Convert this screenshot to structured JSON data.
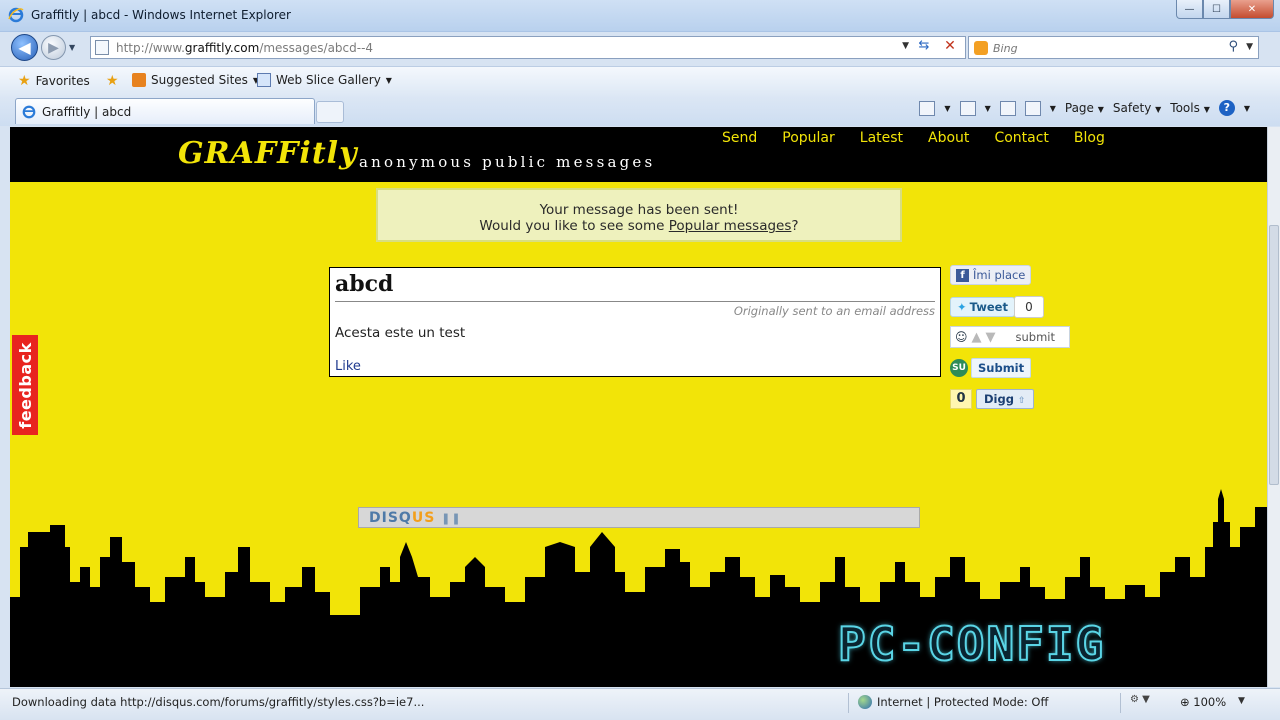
{
  "window": {
    "title": "Graffitly | abcd - Windows Internet Explorer",
    "min": "—",
    "max": "☐",
    "close": "✕"
  },
  "address": {
    "url_prefix": "http://www.",
    "url_host": "graffitly.com",
    "url_path": "/messages/abcd--4",
    "search_placeholder": "Bing"
  },
  "favorites": {
    "favorites_label": "Favorites",
    "suggested_label": "Suggested Sites",
    "webslice_label": "Web Slice Gallery"
  },
  "tab": {
    "title": "Graffitly | abcd"
  },
  "commandbar": {
    "page": "Page",
    "safety": "Safety",
    "tools": "Tools"
  },
  "site": {
    "logo": "GRAFFitly",
    "tagline": "anonymous public messages",
    "nav": [
      "Send",
      "Popular",
      "Latest",
      "About",
      "Contact",
      "Blog"
    ],
    "notice_line1": "Your message has been sent!",
    "notice_line2_pre": "Would you like to see some ",
    "notice_link": "Popular messages",
    "notice_line2_post": "?",
    "message": {
      "title": "abcd",
      "origin": "Originally sent to an email address",
      "body": "Acesta este un test",
      "like": "Like"
    },
    "share": {
      "facebook": "Îmi place",
      "tweet": "Tweet",
      "tweet_count": "0",
      "reddit_submit": "submit",
      "stumble_submit": "Submit",
      "digg_count": "0",
      "digg": "Digg"
    },
    "feedback": "feedback",
    "disqus_a": "DISQ",
    "disqus_b": "US",
    "watermark": "PC-CONFIG"
  },
  "status": {
    "text": "Downloading data http://disqus.com/forums/graffitly/styles.css?b=ie7...",
    "zone": "Internet | Protected Mode: Off",
    "zoom": "100%"
  },
  "colors": {
    "page_bg": "#f2e408",
    "header_bg": "#000000",
    "feedback_bg": "#e8241f"
  }
}
